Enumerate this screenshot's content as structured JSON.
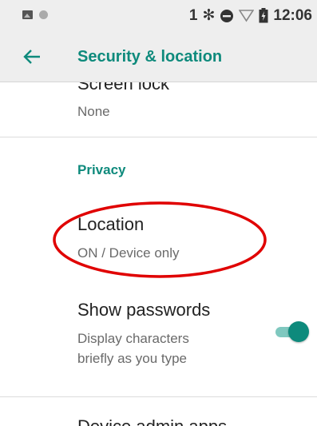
{
  "status_bar": {
    "notification_icons": [
      "image-icon",
      "circle-icon"
    ],
    "bluetooth_number": "1",
    "bluetooth_symbol": "✻",
    "time": "12:06"
  },
  "app_bar": {
    "back_icon": "back-arrow-icon",
    "title": "Security & location"
  },
  "items": {
    "screen_lock": {
      "title": "Screen lock",
      "summary": "None"
    },
    "privacy_header": "Privacy",
    "location": {
      "title": "Location",
      "summary": "ON / Device only"
    },
    "show_passwords": {
      "title": "Show passwords",
      "summary_line1": "Display characters",
      "summary_line2": "briefly as you type",
      "enabled": true
    },
    "next_item_partial": {
      "title": "Device admin apps"
    }
  },
  "colors": {
    "accent": "#0e8a7c",
    "annotation": "#e00000"
  }
}
